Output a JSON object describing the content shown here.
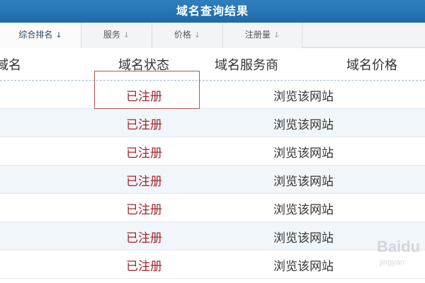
{
  "title": "域名查询结果",
  "sort_tabs": [
    {
      "label": "综合排名",
      "arrow": "↓",
      "active": true
    },
    {
      "label": "服务",
      "arrow": "↓",
      "active": false
    },
    {
      "label": "价格",
      "arrow": "↓",
      "active": false
    },
    {
      "label": "注册量",
      "arrow": "↓",
      "active": false
    }
  ],
  "columns": {
    "domain": "域名",
    "status": "域名状态",
    "vendor": "域名服务商",
    "price": "域名价格"
  },
  "rows": [
    {
      "status": "已注册",
      "link": "浏览该网站"
    },
    {
      "status": "已注册",
      "link": "浏览该网站"
    },
    {
      "status": "已注册",
      "link": "浏览该网站"
    },
    {
      "status": "已注册",
      "link": "浏览该网站"
    },
    {
      "status": "已注册",
      "link": "浏览该网站"
    },
    {
      "status": "已注册",
      "link": "浏览该网站"
    },
    {
      "status": "已注册",
      "link": "浏览该网站"
    }
  ],
  "watermark": {
    "brand": "Baidu",
    "sub": "jingyan"
  },
  "colors": {
    "title_bar": "#1e6aa8",
    "status_text": "#a1252b",
    "highlight_border": "#b05555",
    "row_alt": "#f1f6fa"
  }
}
